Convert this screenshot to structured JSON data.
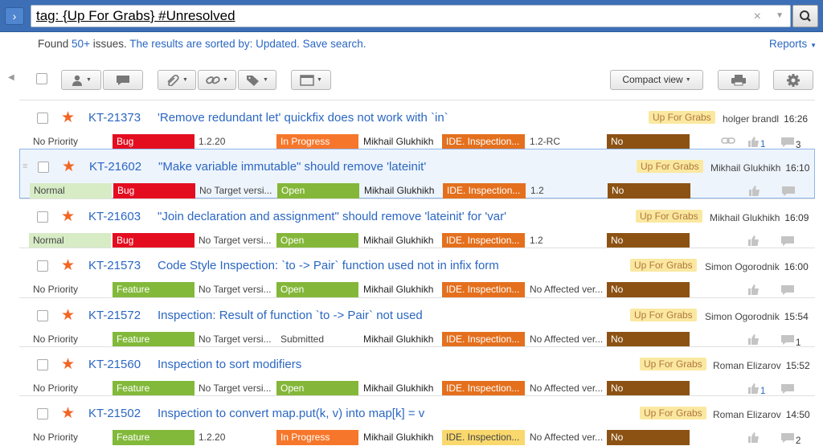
{
  "search": {
    "query": "tag: {Up For Grabs} #Unresolved",
    "nav_icon": "chevron-right-icon",
    "clear_icon": "close-icon",
    "dropdown_icon": "chevron-down-icon",
    "search_icon": "magnifier-icon"
  },
  "summary": {
    "prefix": "Found",
    "count": "50+",
    "issues_word": "issues.",
    "sorted_text": "The results are sorted by: Updated.",
    "save_link": "Save search.",
    "reports": "Reports"
  },
  "toolbar": {
    "buttons": [
      {
        "name": "user-button",
        "icon": "user-icon"
      },
      {
        "name": "comment-button",
        "icon": "comment-icon"
      },
      {
        "name": "attachment-button",
        "icon": "paperclip-icon"
      },
      {
        "name": "link-button",
        "icon": "link-icon"
      },
      {
        "name": "tag-button",
        "icon": "tag-icon"
      },
      {
        "name": "window-button",
        "icon": "window-icon"
      },
      {
        "name": "print-button",
        "icon": "print-icon"
      },
      {
        "name": "settings-button",
        "icon": "gear-icon"
      }
    ],
    "view_label": "Compact view"
  },
  "colors": {
    "accent": "#2b67c2",
    "star": "#f26522",
    "bug": "#e40d20",
    "feature": "#82b93a",
    "in_progress": "#f6772b",
    "open": "#84b739",
    "subsystem": "#e4701e",
    "subsystem_light": "#f9d86e",
    "target": "#8c5213",
    "tag_bg": "#fbe8a0",
    "tag_text": "#b0783b"
  },
  "issues": [
    {
      "id": "KT-21373",
      "summary": "'Remove redundant let' quickfix does not work with `in`",
      "tag": "Up For Grabs",
      "assignee": "holger brandl",
      "time": "16:26",
      "priority": "No Priority",
      "type": "Bug",
      "fix_version": "1.2.20",
      "state": "In Progress",
      "assigned": "Mikhail Glukhikh",
      "subsystem": "IDE. Inspection...",
      "affected": "1.2-RC",
      "target": "No",
      "votes": "1",
      "comments": "3",
      "has_attachment": true
    },
    {
      "id": "KT-21602",
      "summary": "\"Make variable immutable\" should remove 'lateinit'",
      "tag": "Up For Grabs",
      "assignee": "Mikhail Glukhikh",
      "time": "16:10",
      "priority": "Normal",
      "type": "Bug",
      "fix_version": "No Target versi...",
      "state": "Open",
      "assigned": "Mikhail Glukhikh",
      "subsystem": "IDE. Inspection...",
      "affected": "1.2",
      "target": "No",
      "votes": "",
      "comments": "",
      "has_attachment": false
    },
    {
      "id": "KT-21603",
      "summary": "\"Join declaration and assignment\" should remove 'lateinit' for 'var'",
      "tag": "Up For Grabs",
      "assignee": "Mikhail Glukhikh",
      "time": "16:09",
      "priority": "Normal",
      "type": "Bug",
      "fix_version": "No Target versi...",
      "state": "Open",
      "assigned": "Mikhail Glukhikh",
      "subsystem": "IDE. Inspection...",
      "affected": "1.2",
      "target": "No",
      "votes": "",
      "comments": "",
      "has_attachment": false
    },
    {
      "id": "KT-21573",
      "summary": "Code Style Inspection: `to -> Pair` function used not in infix form",
      "tag": "Up For Grabs",
      "assignee": "Simon Ogorodnik",
      "time": "16:00",
      "priority": "No Priority",
      "type": "Feature",
      "fix_version": "No Target versi...",
      "state": "Open",
      "assigned": "Mikhail Glukhikh",
      "subsystem": "IDE. Inspection...",
      "affected": "No Affected ver...",
      "target": "No",
      "votes": "",
      "comments": "",
      "has_attachment": false
    },
    {
      "id": "KT-21572",
      "summary": "Inspection: Result of function `to -> Pair` not used",
      "tag": "Up For Grabs",
      "assignee": "Simon Ogorodnik",
      "time": "15:54",
      "priority": "No Priority",
      "type": "Feature",
      "fix_version": "No Target versi...",
      "state": "Submitted",
      "assigned": "Mikhail Glukhikh",
      "subsystem": "IDE. Inspection...",
      "affected": "No Affected ver...",
      "target": "No",
      "votes": "",
      "comments": "1",
      "has_attachment": false
    },
    {
      "id": "KT-21560",
      "summary": "Inspection to sort modifiers",
      "tag": "Up For Grabs",
      "assignee": "Roman Elizarov",
      "time": "15:52",
      "priority": "No Priority",
      "type": "Feature",
      "fix_version": "No Target versi...",
      "state": "Open",
      "assigned": "Mikhail Glukhikh",
      "subsystem": "IDE. Inspection...",
      "affected": "No Affected ver...",
      "target": "No",
      "votes": "1",
      "comments": "",
      "has_attachment": false
    },
    {
      "id": "KT-21502",
      "summary": "Inspection to convert map.put(k, v) into map[k] = v",
      "tag": "Up For Grabs",
      "assignee": "Roman Elizarov",
      "time": "14:50",
      "priority": "No Priority",
      "type": "Feature",
      "fix_version": "1.2.20",
      "state": "In Progress",
      "assigned": "Mikhail Glukhikh",
      "subsystem": "IDE. Inspection...",
      "affected": "No Affected ver...",
      "target": "No",
      "votes": "",
      "comments": "2",
      "has_attachment": false
    }
  ]
}
